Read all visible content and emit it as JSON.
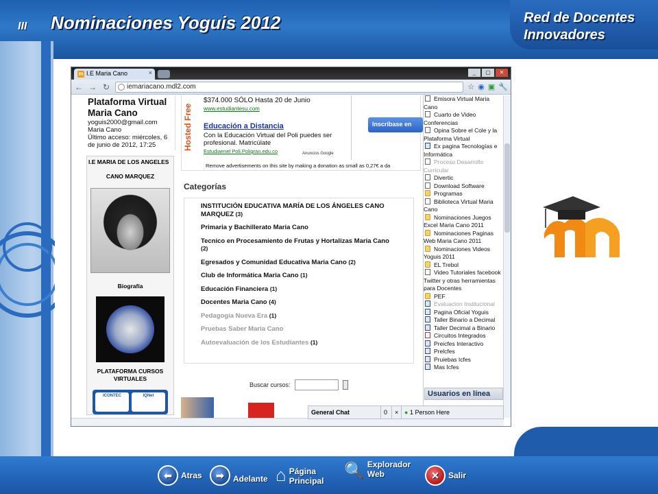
{
  "slide": {
    "roman": "III",
    "title": "Nominaciones Yoguis 2012",
    "corner_title": "Red de Docentes Innovadores"
  },
  "browser": {
    "tab_title": "I.E Maria Cano",
    "tab_favicon": "m",
    "url": "iemariacano.mdl2.com",
    "window_buttons": [
      "_",
      "▢",
      "✕"
    ]
  },
  "user": {
    "name": "Plataforma Virtual Maria Cano",
    "email": "yoguis2000@gmail.com",
    "org": "Maria Cano",
    "last_access": "Último acceso: miércoles, 6 de junio de 2012, 17:25"
  },
  "sidebar": {
    "block1_title": "I.E MARIA DE LOS ANGELES",
    "block1_subtitle": "CANO MARQUEZ",
    "bio_label": "Biografía",
    "block2_title": "PLATAFORMA CURSOS VIRTUALES",
    "cert_left": "ICONTEC",
    "cert_right": "IQNet"
  },
  "ad": {
    "hosted_label": "Hosted Free",
    "price_line": "$374.000 SÓLO Hasta 20 de Junio",
    "url1": "www.estudiantesu.com",
    "title": "Educación a Distancia",
    "desc": "Con la Educación Virtual del Poli puedes ser profesional. Matricúlate",
    "url2": "Estudiaenel Poli.Poligran.edu.co",
    "google": "Anuncios Google",
    "button": "Inscríbase en",
    "remove": "Remove advertisements on this site by making a donation as small as 0,27€ a da"
  },
  "categories": {
    "heading": "Categorías",
    "items": [
      {
        "name": "INSTITUCIÓN EDUCATIVA MARÍA DE LOS ÁNGELES CANO MARQUEZ",
        "count": "(3)",
        "dim": false
      },
      {
        "name": "Primaria y Bachillerato Maria Cano",
        "count": "",
        "dim": false
      },
      {
        "name": "Tecnico en Procesamiento de Frutas y Hortalizas Maria Cano",
        "count": "(2)",
        "dim": false
      },
      {
        "name": "Egresados y Comunidad Educativa Maria Cano",
        "count": "(2)",
        "dim": false
      },
      {
        "name": "Club de Informática Maria Cano",
        "count": "(1)",
        "dim": false
      },
      {
        "name": "Educación Financiera",
        "count": "(1)",
        "dim": false
      },
      {
        "name": "Docentes Maria Cano",
        "count": "(4)",
        "dim": false
      },
      {
        "name": "Pedagogía Nueva Era",
        "count": "(1)",
        "dim": true
      },
      {
        "name": "Pruebas Saber Maria Cano",
        "count": "",
        "dim": true
      },
      {
        "name": "Autoevaluación de los Estudiantes",
        "count": "(1)",
        "dim": true
      }
    ]
  },
  "search": {
    "label": "Buscar cursos:"
  },
  "resources": [
    {
      "icon": "file",
      "text": "Emisora Virtual Maria Cano",
      "dim": false
    },
    {
      "icon": "file",
      "text": "Cuarto de Video Conferencias",
      "dim": false
    },
    {
      "icon": "file",
      "text": "Opina Sobre el Cole y la Plataforma Virtual",
      "dim": false
    },
    {
      "icon": "blue",
      "text": "Ex pagina Tecnologías e Informática",
      "dim": false
    },
    {
      "icon": "file",
      "text": "Proceso Desarrollo Curricular",
      "dim": true
    },
    {
      "icon": "file",
      "text": "Divertic",
      "dim": false
    },
    {
      "icon": "file",
      "text": "Download Software",
      "dim": false
    },
    {
      "icon": "folder",
      "text": "Programas",
      "dim": false
    },
    {
      "icon": "file",
      "text": "Biblioteca Virtual Maria Cano",
      "dim": false
    },
    {
      "icon": "folder",
      "text": "Nominaciones Juegos Excel Maria Cano 2011",
      "dim": false
    },
    {
      "icon": "folder",
      "text": "Nominaciones Paginas Web Maria Cano 2011",
      "dim": false
    },
    {
      "icon": "folder",
      "text": "Nominaciones Videos Yoguis 2011",
      "dim": false
    },
    {
      "icon": "folder",
      "text": "EL Trebol",
      "dim": false
    },
    {
      "icon": "file",
      "text": "Video Tutoriales facebook Twitter y otras herramientas para Docentes",
      "dim": false
    },
    {
      "icon": "folder",
      "text": "PEF",
      "dim": false
    },
    {
      "icon": "blue",
      "text": "Evaluacion Institucional",
      "dim": true
    },
    {
      "icon": "blue",
      "text": "Pagina Oficial Yoguis",
      "dim": false
    },
    {
      "icon": "blue",
      "text": "Taller Binario a Decimal",
      "dim": false
    },
    {
      "icon": "blue",
      "text": "Taller Decimal a Binario",
      "dim": false
    },
    {
      "icon": "pdf",
      "text": "Circuitos Integrados",
      "dim": false
    },
    {
      "icon": "blue",
      "text": "Preicfes Interactivo",
      "dim": false
    },
    {
      "icon": "blue",
      "text": "Prelcfes",
      "dim": false
    },
    {
      "icon": "blue",
      "text": "Pruiebas Icfes",
      "dim": false
    },
    {
      "icon": "blue",
      "text": "Mas Icfes",
      "dim": false
    }
  ],
  "users_online": "Usuarios en línea",
  "chat": {
    "label": "General Chat",
    "count": "0",
    "close": "×",
    "people": "1 Person Here"
  },
  "bottom_nav": {
    "back": "Atras",
    "forward": "Adelante",
    "home": "Página Principal",
    "explorer": "Explorador Web",
    "exit": "Salir"
  }
}
